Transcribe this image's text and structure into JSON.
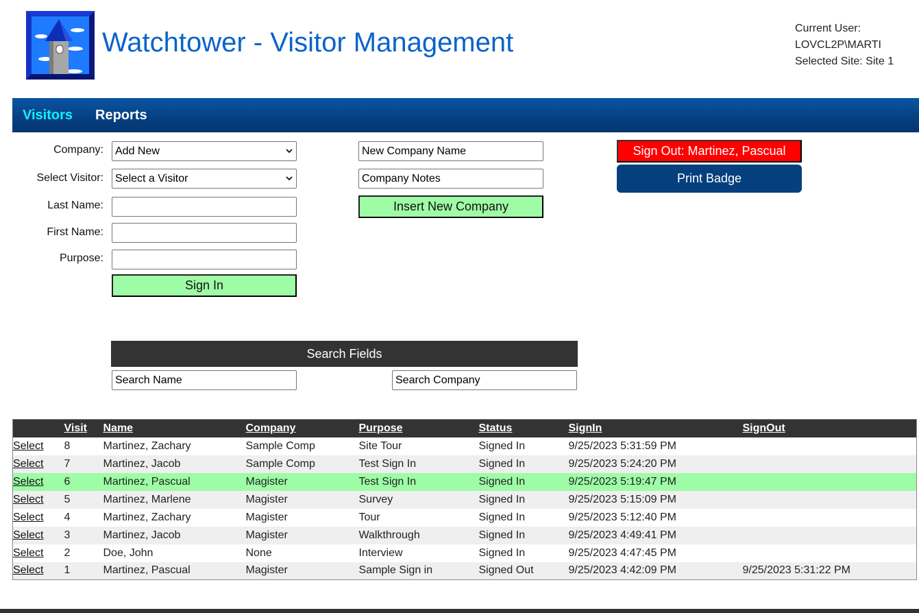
{
  "header": {
    "title": "Watchtower - Visitor Management",
    "logo_icon": "watchtower-logo",
    "current_user_label": "Current User:",
    "current_user": "LOVCL2P\\MARTI",
    "selected_site": "Selected Site: Site 1"
  },
  "nav": {
    "items": [
      {
        "label": "Visitors",
        "active": true
      },
      {
        "label": "Reports",
        "active": false
      }
    ]
  },
  "form": {
    "company_label": "Company:",
    "company_value": "Add New",
    "visitor_label": "Select Visitor:",
    "visitor_value": "Select a Visitor",
    "last_name_label": "Last Name:",
    "last_name_value": "",
    "first_name_label": "First Name:",
    "first_name_value": "",
    "purpose_label": "Purpose:",
    "purpose_value": "",
    "sign_in_label": "Sign In"
  },
  "company_form": {
    "name_value": "New Company Name",
    "notes_value": "Company Notes",
    "insert_label": "Insert New Company"
  },
  "actions": {
    "sign_out_label": "Sign Out: Martinez, Pascual",
    "print_badge_label": "Print Badge"
  },
  "search": {
    "header": "Search Fields",
    "name_value": "Search Name",
    "company_value": "Search Company"
  },
  "table": {
    "select_label": "Select",
    "columns": [
      "",
      "Visit",
      "Name",
      "Company",
      "Purpose",
      "Status",
      "SignIn",
      "SignOut"
    ],
    "rows": [
      {
        "visit": "8",
        "name": "Martinez, Zachary",
        "company": "Sample Comp",
        "purpose": "Site Tour",
        "status": "Signed In",
        "signin": "9/25/2023 5:31:59 PM",
        "signout": ""
      },
      {
        "visit": "7",
        "name": "Martinez, Jacob",
        "company": "Sample Comp",
        "purpose": "Test Sign In",
        "status": "Signed In",
        "signin": "9/25/2023 5:24:20 PM",
        "signout": ""
      },
      {
        "visit": "6",
        "name": "Martinez, Pascual",
        "company": "Magister",
        "purpose": "Test Sign In",
        "status": "Signed In",
        "signin": "9/25/2023 5:19:47 PM",
        "signout": "",
        "selected": true
      },
      {
        "visit": "5",
        "name": "Martinez, Marlene",
        "company": "Magister",
        "purpose": "Survey",
        "status": "Signed In",
        "signin": "9/25/2023 5:15:09 PM",
        "signout": ""
      },
      {
        "visit": "4",
        "name": "Martinez, Zachary",
        "company": "Magister",
        "purpose": "Tour",
        "status": "Signed In",
        "signin": "9/25/2023 5:12:40 PM",
        "signout": ""
      },
      {
        "visit": "3",
        "name": "Martinez, Jacob",
        "company": "Magister",
        "purpose": "Walkthrough",
        "status": "Signed In",
        "signin": "9/25/2023 4:49:41 PM",
        "signout": ""
      },
      {
        "visit": "2",
        "name": "Doe, John",
        "company": "None",
        "purpose": "Interview",
        "status": "Signed In",
        "signin": "9/25/2023 4:47:45 PM",
        "signout": ""
      },
      {
        "visit": "1",
        "name": "Martinez, Pascual",
        "company": "Magister",
        "purpose": "Sample Sign in",
        "status": "Signed Out",
        "signin": "9/25/2023 4:42:09 PM",
        "signout": "9/25/2023 5:31:22 PM"
      }
    ]
  },
  "colors": {
    "brand_blue": "#0a63c9",
    "nav_bg": "#053f7d",
    "nav_active": "#10f0ff",
    "button_green": "#9ffca6",
    "sign_out_red": "#ff0000",
    "table_header": "#333333",
    "selected_row": "#9efca6"
  }
}
